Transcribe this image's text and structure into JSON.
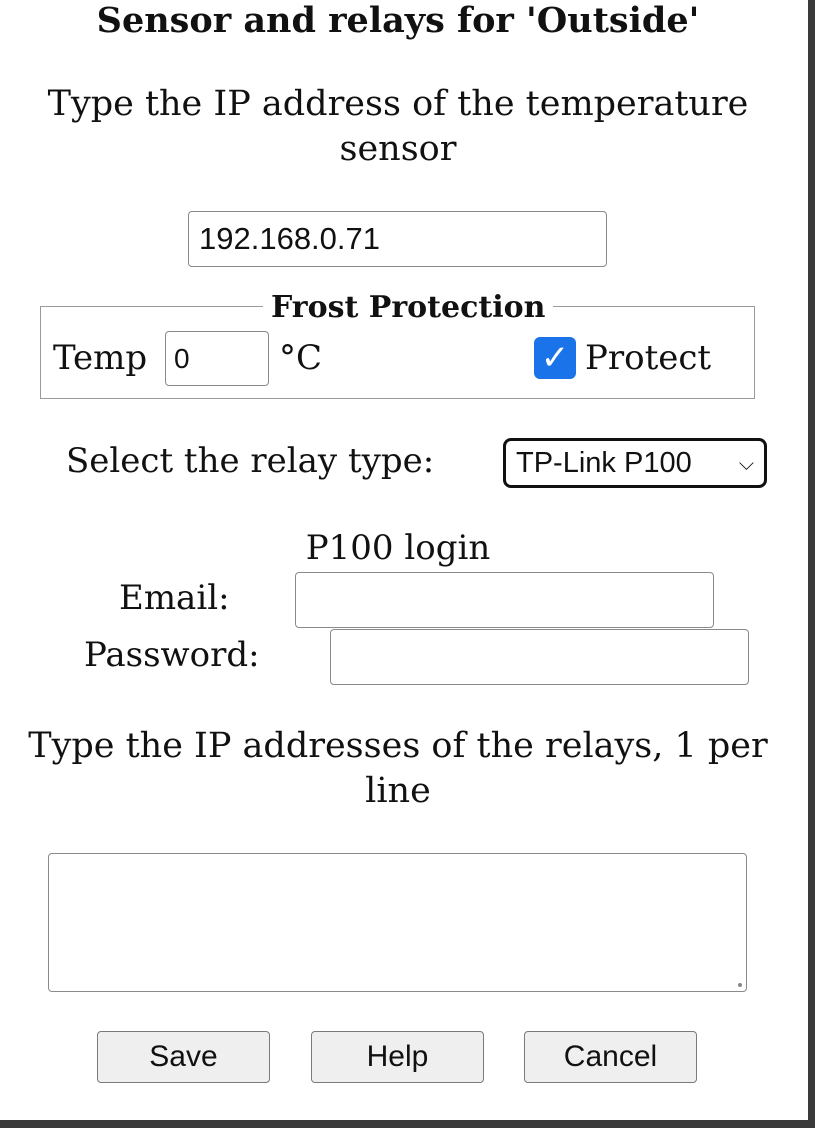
{
  "dialog": {
    "title": "Sensor and relays for 'Outside'"
  },
  "sensor": {
    "prompt": "Type the IP address of the temperature sensor",
    "ip_value": "192.168.0.71"
  },
  "frost_protection": {
    "legend": "Frost Protection",
    "temp_label": "Temp",
    "temp_value": "0",
    "unit": "°C",
    "protect_checked": true,
    "protect_label": "Protect",
    "checkbox_color": "#1a73e8",
    "check_icon": "check-icon"
  },
  "relay_type": {
    "label": "Select the relay type:",
    "selected": "TP-Link P100",
    "chevron_icon": "chevron-down-icon"
  },
  "login": {
    "heading": "P100 login",
    "email_label": "Email:",
    "email_value": "",
    "password_label": "Password:",
    "password_value": ""
  },
  "relays": {
    "prompt": "Type the IP addresses of the relays, 1 per line",
    "value": ""
  },
  "buttons": {
    "save": "Save",
    "help": "Help",
    "cancel": "Cancel"
  }
}
